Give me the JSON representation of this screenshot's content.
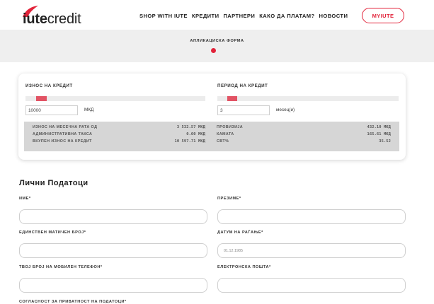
{
  "header": {
    "logo_bold": "iute",
    "logo_light": "credit",
    "nav": [
      "SHOP WITH IUTE",
      "КРЕДИТИ",
      "ПАРТНЕРИ",
      "КАКО ДА ПЛАТАМ?",
      "НОВОСТИ"
    ],
    "myiute": "MYIUTE",
    "accent": "#e2233a"
  },
  "band": {
    "title": "АПЛИКАЦИСКА ФОРМА"
  },
  "loan": {
    "amount_label": "ИЗНОС НА КРЕДИТ",
    "amount_value": "10000",
    "amount_unit": "МКД",
    "period_label": "ПЕРИОД НА КРЕДИТ",
    "period_value": "3",
    "period_unit": "месец(и)",
    "summary_left": [
      {
        "label": "ИЗНОС НА МЕСЕЧНА РАТА ОД",
        "value": "3 532.57 МКД"
      },
      {
        "label": "АДМИНИСТРАТИВНА ТАКСА",
        "value": "0.00 МКД"
      },
      {
        "label": "ВКУПЕН ИЗНОС НА КРЕДИТ",
        "value": "10 597.71 МКД"
      }
    ],
    "summary_right": [
      {
        "label": "ПРОВИЗИЈА",
        "value": "432.10 МКД"
      },
      {
        "label": "КАМАТА",
        "value": "165.61 МКД"
      },
      {
        "label": "СВТ%",
        "value": "35.52"
      }
    ]
  },
  "personal": {
    "title": "Лични Податоци",
    "first_name": "ИМЕ*",
    "last_name": "ПРЕЗИМЕ*",
    "embg": "ЕДИНСТВЕН МАТИЧЕН БРОЈ*",
    "birth_date": "ДАТУМ НА РАЃАЊЕ*",
    "birth_placeholder": "01.12.1985",
    "phone": "ТВОЈ БРОЈ НА МОБИЛЕН ТЕЛЕФОН*",
    "email": "ЕЛЕКТРОНСКА ПОШТА*",
    "consent_cutoff": "СОГЛАСНОСТ ЗА ПРИВАТНОСТ НА ПОДАТОЦИ*"
  }
}
